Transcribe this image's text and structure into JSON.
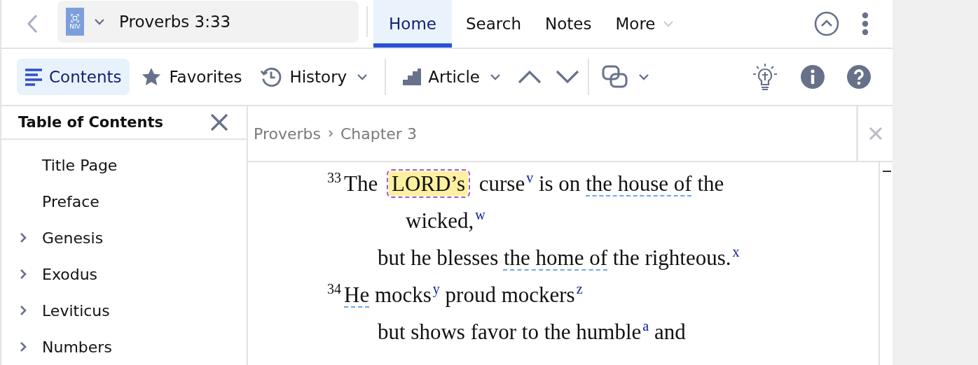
{
  "nav": {
    "reference": "Proverbs 3:33",
    "version_badge": "NIV"
  },
  "tabs": [
    {
      "label": "Home",
      "selected": true,
      "has_menu": false
    },
    {
      "label": "Search",
      "selected": false,
      "has_menu": false
    },
    {
      "label": "Notes",
      "selected": false,
      "has_menu": false
    },
    {
      "label": "More",
      "selected": false,
      "has_menu": true
    }
  ],
  "toolbar": [
    {
      "label": "Contents",
      "selected": true,
      "has_menu": false
    },
    {
      "label": "Favorites",
      "selected": false,
      "has_menu": false
    },
    {
      "label": "History",
      "selected": false,
      "has_menu": true
    },
    {
      "label": "Article",
      "selected": false,
      "has_menu": true
    }
  ],
  "sidebar": {
    "title": "Table of Contents",
    "items": [
      {
        "label": "Title Page",
        "has_children": false
      },
      {
        "label": "Preface",
        "has_children": false
      },
      {
        "label": "Genesis",
        "has_children": true
      },
      {
        "label": "Exodus",
        "has_children": true
      },
      {
        "label": "Leviticus",
        "has_children": true
      },
      {
        "label": "Numbers",
        "has_children": true
      }
    ]
  },
  "reader": {
    "breadcrumb": [
      "Proverbs",
      "Chapter 3"
    ],
    "lines": [
      {
        "kind": "verse",
        "parts": [
          {
            "kind": "verse_number",
            "text": "33"
          },
          {
            "kind": "text",
            "text": "The "
          },
          {
            "kind": "highlight",
            "text": "LORD’s"
          },
          {
            "kind": "text",
            "text": " curse"
          },
          {
            "kind": "note",
            "text": "v"
          },
          {
            "kind": "text",
            "text": " is on "
          },
          {
            "kind": "link",
            "text": "the house of"
          },
          {
            "kind": "text",
            "text": " the"
          }
        ]
      },
      {
        "kind": "wrap",
        "parts": [
          {
            "kind": "text",
            "text": "wicked,"
          },
          {
            "kind": "note",
            "text": "w"
          }
        ]
      },
      {
        "kind": "second",
        "parts": [
          {
            "kind": "text",
            "text": "but he blesses "
          },
          {
            "kind": "link",
            "text": "the home of"
          },
          {
            "kind": "text",
            "text": " the righteous."
          },
          {
            "kind": "note",
            "text": "x"
          }
        ]
      },
      {
        "kind": "verse",
        "parts": [
          {
            "kind": "verse_number",
            "text": "34"
          },
          {
            "kind": "link",
            "text": "He"
          },
          {
            "kind": "text",
            "text": " mocks"
          },
          {
            "kind": "note",
            "text": "y"
          },
          {
            "kind": "text",
            "text": " proud mockers"
          },
          {
            "kind": "note",
            "text": "z"
          }
        ]
      },
      {
        "kind": "second",
        "parts": [
          {
            "kind": "text",
            "text": "but shows favor to the humble"
          },
          {
            "kind": "note",
            "text": "a"
          },
          {
            "kind": "text",
            "text": " and"
          }
        ]
      }
    ]
  }
}
